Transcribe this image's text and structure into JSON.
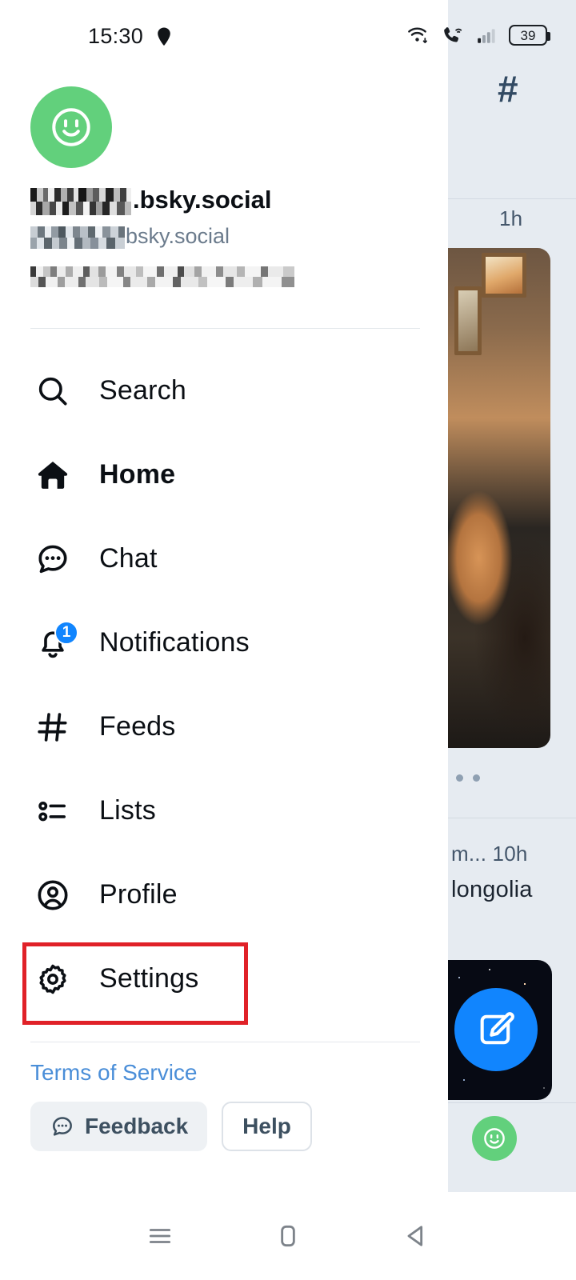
{
  "status_bar": {
    "time": "15:30",
    "left_icon": "location-pin-icon",
    "wifi_icon": "wifi-icon",
    "wifi_calling_icon": "wifi-calling-icon",
    "signal_icon": "cellular-signal-icon",
    "battery_level": "39"
  },
  "drawer": {
    "avatar_icon": "smiley-face-avatar",
    "avatar_color": "#62d07c",
    "profile_name_suffix": ".bsky.social",
    "profile_name_redacted": true,
    "profile_handle_suffix": "bsky.social",
    "profile_handle_redacted": true,
    "profile_stats_redacted": true,
    "nav": [
      {
        "label": "Search",
        "icon": "search-icon",
        "active": false,
        "badge": null
      },
      {
        "label": "Home",
        "icon": "home-icon",
        "active": true,
        "badge": null
      },
      {
        "label": "Chat",
        "icon": "chat-bubble-icon",
        "active": false,
        "badge": null
      },
      {
        "label": "Notifications",
        "icon": "bell-icon",
        "active": false,
        "badge": "1"
      },
      {
        "label": "Feeds",
        "icon": "hashtag-icon",
        "active": false,
        "badge": null
      },
      {
        "label": "Lists",
        "icon": "list-icon",
        "active": false,
        "badge": null
      },
      {
        "label": "Profile",
        "icon": "person-circle-icon",
        "active": false,
        "badge": null
      },
      {
        "label": "Settings",
        "icon": "gear-icon",
        "active": false,
        "badge": null
      }
    ],
    "footer": {
      "terms_link": "Terms of Service",
      "feedback_label": "Feedback",
      "feedback_icon": "chat-dots-icon",
      "help_label": "Help"
    },
    "highlight": {
      "target": "Settings",
      "color": "#e02128"
    }
  },
  "background_feed": {
    "hashtag_icon": "hashtag-icon",
    "post_1_time": "1h",
    "post_2_time": "m... 10h",
    "post_2_text": "longolia",
    "compose_icon": "compose-pencil-icon",
    "compose_color": "#1185fe",
    "mini_avatar_icon": "smiley-face-avatar"
  },
  "android_nav": {
    "recents_icon": "recents-icon",
    "home_icon": "home-square-icon",
    "back_icon": "back-triangle-icon"
  }
}
